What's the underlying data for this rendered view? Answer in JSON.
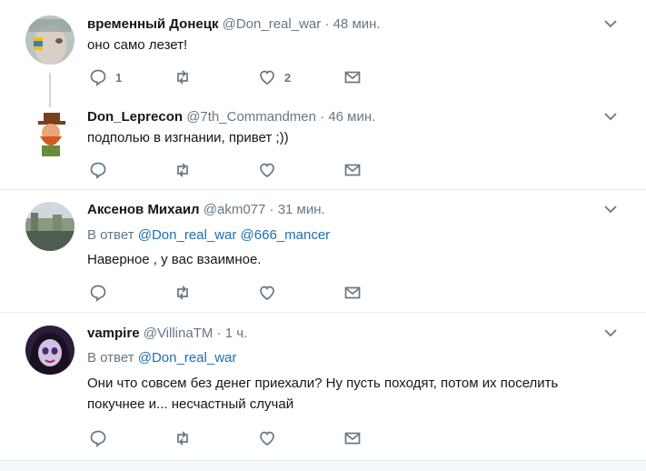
{
  "tweets": [
    {
      "name": "временный Донецк",
      "handle": "@Don_real_war",
      "dot": "·",
      "time": "48 мин.",
      "reply_prefix": "",
      "reply_mentions": [],
      "text": "оно само лезет!",
      "reply_count": "1",
      "like_count": "2",
      "avatar_icon": "face-paint-avatar"
    },
    {
      "name": "Don_Leprecon",
      "handle": "@7th_Commandmen",
      "dot": "·",
      "time": "46 мин.",
      "reply_prefix": "",
      "reply_mentions": [],
      "text": "подполью в изгнании, привет ;))",
      "reply_count": "",
      "like_count": "",
      "avatar_icon": "leprechaun-avatar"
    },
    {
      "name": "Аксенов Михаил",
      "handle": "@akm077",
      "dot": "·",
      "time": "31 мин.",
      "reply_prefix": "В ответ",
      "reply_mentions": [
        "@Don_real_war",
        "@666_mancer"
      ],
      "text": "Наверное , у вас взаимное.",
      "reply_count": "",
      "like_count": "",
      "avatar_icon": "city-photo-avatar"
    },
    {
      "name": "vampire",
      "handle": "@VillinaTM",
      "dot": "·",
      "time": "1 ч.",
      "reply_prefix": "В ответ",
      "reply_mentions": [
        "@Don_real_war"
      ],
      "text_lines": [
        "Они что совсем без денег приехали? Ну пусть походят, потом их поселить",
        "покучнее и... несчастный случай"
      ],
      "reply_count": "",
      "like_count": "",
      "avatar_icon": "vampire-cartoon-avatar"
    }
  ],
  "colors": {
    "icon": "#657786",
    "link": "#1b6fb3",
    "divider": "#e6ecf0",
    "text": "#14171a"
  }
}
